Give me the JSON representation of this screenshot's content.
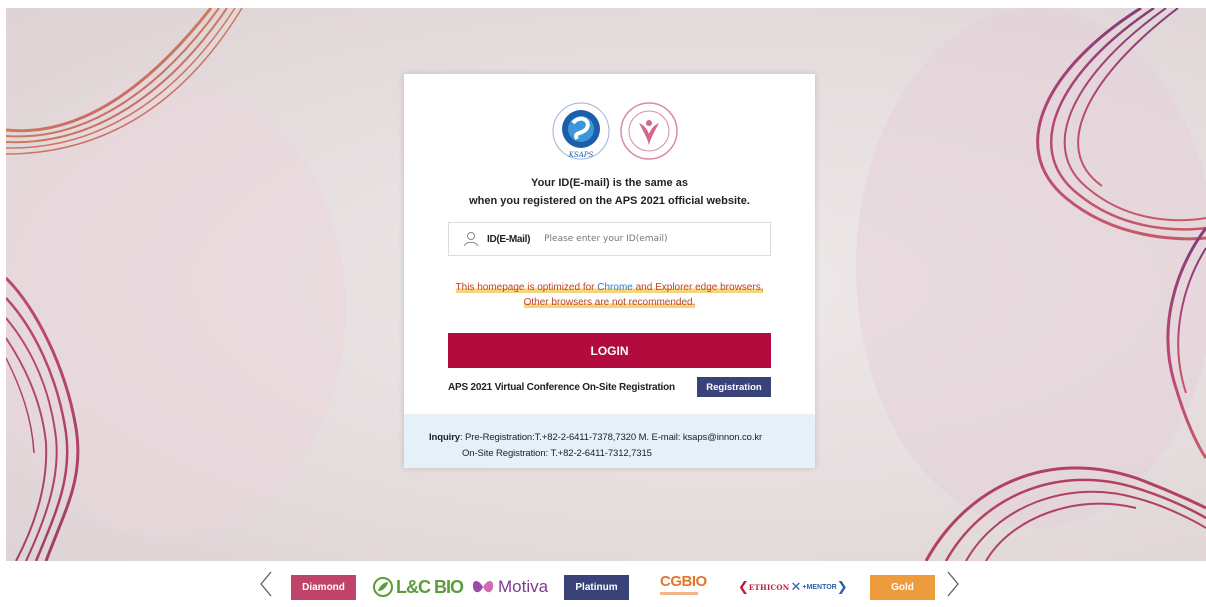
{
  "auth": {
    "message_line1": "Your ID(E-mail) is the same as",
    "message_line2": "when you registered on the APS 2021 official website.",
    "id_label": "ID(E-Mail)",
    "id_placeholder": "Please enter your ID(email)",
    "notice_pre": "This homepage is optimized for ",
    "notice_chrome": "Chrome",
    "notice_post": " and Explorer edge browsers,",
    "notice_line2": "Other browsers are not recommended.",
    "login_label": "LOGIN",
    "onsite_text": "APS 2021 Virtual Conference On-Site Registration",
    "registration_label": "Registration",
    "logo1_text": "KSAPS"
  },
  "inquiry": {
    "label": "Inquiry",
    "line1": ": Pre-Registration:T.+82-2-6411-7378,7320 M. E-mail: ksaps@innon.co.kr",
    "line2": "On-Site Registration: T.+82-2-6411-7312,7315"
  },
  "sponsors": {
    "tier_diamond": "Diamond",
    "tier_platinum": "Platinum",
    "tier_gold": "Gold",
    "lc_bio": "L&C BIO",
    "motiva": "Motiva",
    "cgbio": "CGBIO",
    "ethicon": "ETHICON",
    "mentor": "+MENTOR"
  },
  "colors": {
    "login": "#b20c3f",
    "registration": "#3a4377",
    "diamond": "#c0446a",
    "platinum": "#3a4377",
    "gold": "#ee9b3d"
  }
}
